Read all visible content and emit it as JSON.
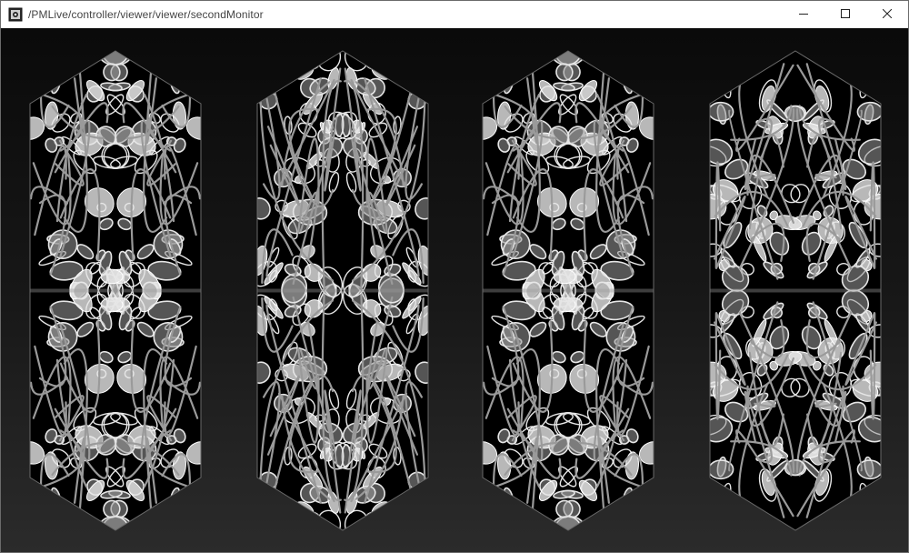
{
  "window": {
    "title": "/PMLive/controller/viewer/viewer/secondMonitor",
    "icon": "app-icon"
  },
  "controls": {
    "minimize": "minimize-icon",
    "maximize": "maximize-icon",
    "close": "close-icon"
  },
  "viewport": {
    "panels": [
      {
        "id": "panel-1",
        "variant": "a"
      },
      {
        "id": "panel-2",
        "variant": "b"
      },
      {
        "id": "panel-3",
        "variant": "a"
      },
      {
        "id": "panel-4",
        "variant": "c"
      }
    ],
    "colors": {
      "pattern_light": "#e6e6e6",
      "pattern_mid": "#9a9a9a",
      "pattern_dark": "#000000"
    }
  }
}
